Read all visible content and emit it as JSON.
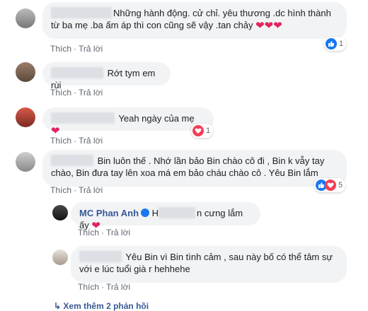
{
  "actions": {
    "like_label": "Thích",
    "reply_label": "Trả lời",
    "separator": "·"
  },
  "comments": [
    {
      "text": "Những hành động. cử chỉ. yêu thương .dc hình thành từ ba mẹ .ba ấm áp thì con cũng sẽ vậy .tan chảy",
      "reaction_count": "1"
    },
    {
      "text": "Rớt tym em rùi"
    },
    {
      "text": "Yeah ngày của mẹ",
      "reaction_count": "1"
    },
    {
      "text": "Bin luôn thế . Nhớ lần bảo Bin chào cô đi , Bin k vẫy tay chào, Bin đưa tay lên xoa má em bảo cháu chào cô . Yêu Bin lắm",
      "reaction_count": "5"
    }
  ],
  "replies": [
    {
      "author": "MC Phan Anh",
      "text_prefix": "H",
      "text_suffix": "n cưng lắm ấy"
    },
    {
      "text": "Yêu Bin vì Bin tình cảm , sau này bố có thể tâm sự với e lúc tuổi già r hehhehe"
    }
  ],
  "more_replies": "Xem thêm 2 phản hồi",
  "colors": {
    "like": "#1877f2",
    "love": "#f33e58",
    "link": "#385898",
    "bubble": "#f2f3f5"
  }
}
